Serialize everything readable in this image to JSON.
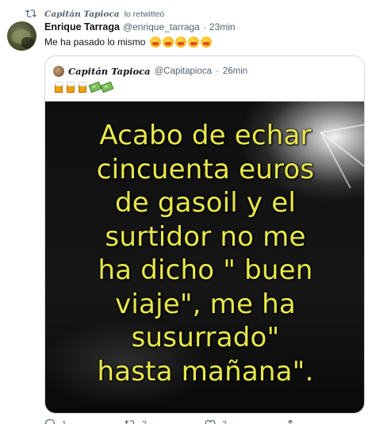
{
  "retweet": {
    "name": "Capitán Tapioca",
    "text": "lo retwitteó"
  },
  "tweet": {
    "name": "Enrique Tarraga",
    "handle": "@enrique_tarraga",
    "sep": "·",
    "time": "23min",
    "text": "Me ha pasado lo mismo"
  },
  "quote": {
    "name": "Capitán Tapioca",
    "handle": "@Capitapioca",
    "sep": "·",
    "time": "26min",
    "image_lines": [
      "Acabo de echar",
      "cincuenta euros",
      "de gasoil y el",
      "surtidor no me",
      "ha dicho \" buen",
      "viaje\", me ha",
      "susurrado\"",
      "hasta mañana\"."
    ]
  },
  "actions": {
    "reply_count": "1",
    "retweet_count": "2",
    "like_count": "2",
    "share_label": ""
  },
  "colors": {
    "accent": "#1d9bf0",
    "secondary_text": "#536471",
    "image_text": "#e8e84a"
  }
}
